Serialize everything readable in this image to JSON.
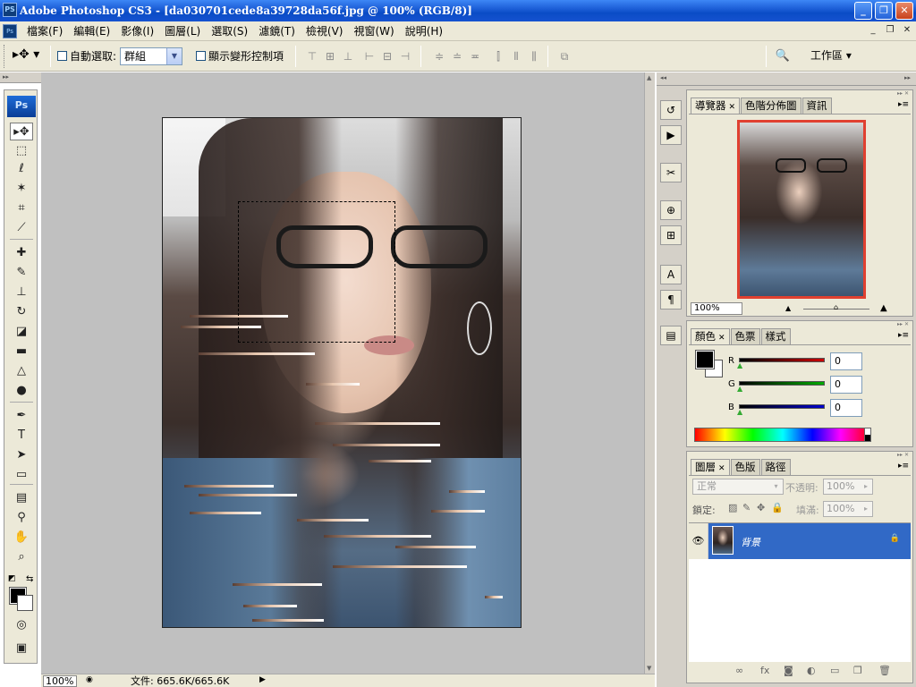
{
  "window": {
    "app_icon": "PS",
    "title": "Adobe Photoshop CS3 - [da030701cede8a39728da56f.jpg @ 100% (RGB/8)]",
    "buttons": {
      "minimize": "_",
      "maximize": "❐",
      "close": "✕"
    }
  },
  "menubar": {
    "doc_icon": "Ps",
    "items": [
      "檔案(F)",
      "編輯(E)",
      "影像(I)",
      "圖層(L)",
      "選取(S)",
      "濾鏡(T)",
      "檢視(V)",
      "視窗(W)",
      "說明(H)"
    ],
    "mdi_buttons": {
      "minimize": "_",
      "restore": "❐",
      "close": "✕"
    }
  },
  "options": {
    "tool_preset": "▸✥ ▾",
    "auto_select_label": "自動選取:",
    "auto_select_value": "群組",
    "show_transform_label": "顯示變形控制項",
    "align_icons": [
      "⊤",
      "⊞",
      "⊥",
      "⊢",
      "⊟",
      "⊣"
    ],
    "distribute_icons": [
      "≑",
      "≐",
      "≖",
      "⫿",
      "⦀",
      "⫼"
    ],
    "auto_align_icon": "⧉",
    "bridge_icon": "🔍",
    "workspace_label": "工作區 ▾"
  },
  "toolbox": {
    "logo": "Ps",
    "tools": [
      {
        "name": "move-tool-icon",
        "glyph": "▸✥"
      },
      {
        "name": "marquee-tool-icon",
        "glyph": "⬚"
      },
      {
        "name": "lasso-tool-icon",
        "glyph": "ℓ"
      },
      {
        "name": "magic-wand-tool-icon",
        "glyph": "✶"
      },
      {
        "name": "crop-tool-icon",
        "glyph": "⌗"
      },
      {
        "name": "slice-tool-icon",
        "glyph": "⟋"
      },
      {
        "name": "healing-brush-tool-icon",
        "glyph": "✚"
      },
      {
        "name": "brush-tool-icon",
        "glyph": "✎"
      },
      {
        "name": "clone-stamp-tool-icon",
        "glyph": "⊥"
      },
      {
        "name": "history-brush-tool-icon",
        "glyph": "↻"
      },
      {
        "name": "eraser-tool-icon",
        "glyph": "◪"
      },
      {
        "name": "gradient-tool-icon",
        "glyph": "▬"
      },
      {
        "name": "blur-tool-icon",
        "glyph": "△"
      },
      {
        "name": "dodge-tool-icon",
        "glyph": "●"
      },
      {
        "name": "pen-tool-icon",
        "glyph": "✒"
      },
      {
        "name": "type-tool-icon",
        "glyph": "T"
      },
      {
        "name": "path-selection-tool-icon",
        "glyph": "➤"
      },
      {
        "name": "shape-tool-icon",
        "glyph": "▭"
      },
      {
        "name": "notes-tool-icon",
        "glyph": "▤"
      },
      {
        "name": "eyedropper-tool-icon",
        "glyph": "⚲"
      },
      {
        "name": "hand-tool-icon",
        "glyph": "✋"
      },
      {
        "name": "zoom-tool-icon",
        "glyph": "⌕"
      }
    ],
    "default_colors_icon": "◩",
    "swap_colors_icon": "⇆",
    "quick_mask_icon": "◎",
    "screen_mode_icon": "▣"
  },
  "statusbar": {
    "zoom": "100%",
    "doc_icon": "◉",
    "doc_size": "文件: 665.6K/665.6K",
    "menu_arrow": "▶"
  },
  "dock": {
    "collapse_left": "◂◂",
    "collapse_right": "▸▸",
    "icon_buttons": [
      "↺",
      "▶",
      "✂",
      "⊕",
      "⊞",
      "A",
      "¶",
      "▤"
    ]
  },
  "navigator": {
    "tabs": [
      "導覽器",
      "色階分佈圖",
      "資訊"
    ],
    "tab_close": "✕",
    "zoom": "100%",
    "zoom_out_icon": "▲",
    "zoom_slider_knob": "⌂",
    "zoom_in_icon": "▲",
    "menu_icon": "▸≡"
  },
  "color": {
    "tabs": [
      "顏色",
      "色票",
      "樣式"
    ],
    "tab_close": "✕",
    "channels": [
      {
        "label": "R",
        "value": "0",
        "color": "#cc0000"
      },
      {
        "label": "G",
        "value": "0",
        "color": "#00aa00"
      },
      {
        "label": "B",
        "value": "0",
        "color": "#0000cc"
      }
    ],
    "slider_marker": "▲",
    "menu_icon": "▸≡",
    "fg_color": "#000000",
    "bg_color": "#ffffff"
  },
  "layers": {
    "tabs": [
      "圖層",
      "色版",
      "路徑"
    ],
    "tab_close": "✕",
    "blend_mode": "正常",
    "opacity_label": "不透明:",
    "opacity_value": "100%",
    "lock_label": "鎖定:",
    "lock_icons": [
      "▨",
      "✎",
      "✥",
      "🔒"
    ],
    "fill_label": "填滿:",
    "fill_value": "100%",
    "dropdown_arrow": "▾",
    "field_arrow": "▸",
    "layer_name": "背景",
    "eye_icon": "👁",
    "layer_lock_icon": "🔒",
    "footer_icons": [
      "∞",
      "fx",
      "◙",
      "◐",
      "▭",
      "❐",
      "🗑"
    ],
    "menu_icon": "▸≡",
    "selected_color": "#3169c6"
  },
  "canvas": {
    "selection_visible": true
  }
}
